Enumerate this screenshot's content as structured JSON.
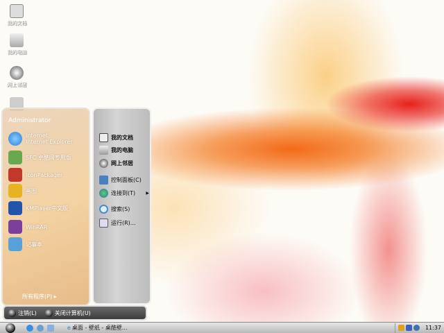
{
  "desktop": {
    "icons": [
      {
        "label": "我的文档",
        "icon": "my-documents-icon"
      },
      {
        "label": "我的电脑",
        "icon": "my-computer-icon"
      },
      {
        "label": "网上邻居",
        "icon": "network-icon"
      },
      {
        "label": "",
        "icon": "recycle-bin-icon"
      }
    ]
  },
  "start_menu": {
    "user": "Administrator",
    "programs": [
      {
        "line1": "Internet",
        "line2": "Internet Explorer",
        "icon": "ie-icon",
        "color": "#2a7fd6"
      },
      {
        "label": "SFC 卓酷网专用版",
        "icon": "sfc-icon",
        "color": "#6aa84f"
      },
      {
        "label": "IconPackager",
        "icon": "iconpackager-icon",
        "color": "#c0392b"
      },
      {
        "label": "画图",
        "icon": "paint-icon",
        "color": "#e6b422"
      },
      {
        "label": "KMPlayer中文版",
        "icon": "kmplayer-icon",
        "color": "#2255aa"
      },
      {
        "label": "WinRAR",
        "icon": "winrar-icon",
        "color": "#7b3f9e"
      },
      {
        "label": "记事本",
        "icon": "notepad-icon",
        "color": "#5aa0d8"
      }
    ],
    "all_programs": "所有程序(P)",
    "places": [
      {
        "label": "我的文档",
        "icon": "my-documents-icon",
        "bold": true
      },
      {
        "label": "我的电脑",
        "icon": "my-computer-icon",
        "bold": true
      },
      {
        "label": "网上邻居",
        "icon": "network-icon",
        "bold": true
      },
      {
        "label": "控制面板(C)",
        "icon": "control-panel-icon",
        "bold": false
      },
      {
        "label": "连接到(T)",
        "icon": "connect-icon",
        "bold": false,
        "submenu": true
      },
      {
        "label": "搜索(S)",
        "icon": "search-icon",
        "bold": false
      },
      {
        "label": "运行(R)...",
        "icon": "run-icon",
        "bold": false
      }
    ],
    "logoff": "注销(L)",
    "shutdown": "关闭计算机(U)"
  },
  "taskbar": {
    "task": "桌面 - 壁纸 - 桌酷壁...",
    "clock": "11:37"
  }
}
